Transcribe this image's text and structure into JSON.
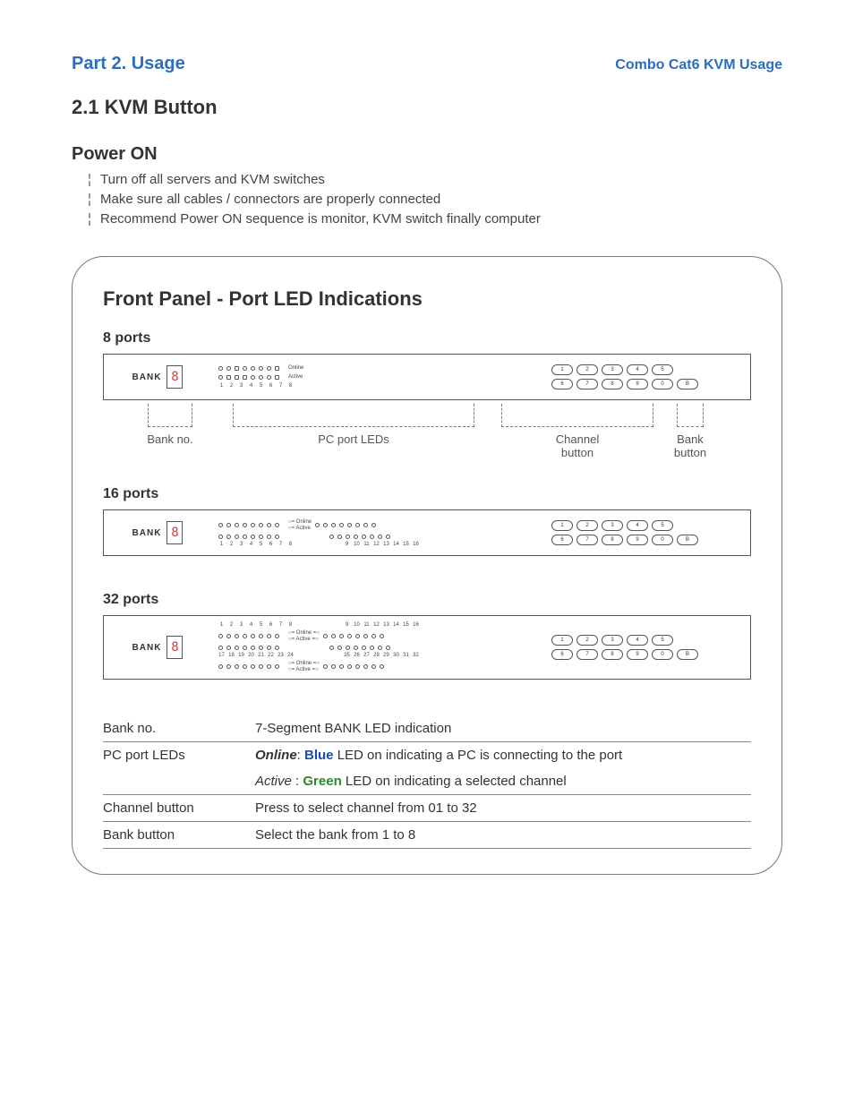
{
  "header": {
    "left": "Part 2. Usage",
    "right": "Combo Cat6 KVM Usage"
  },
  "section_title": "2.1  KVM Button",
  "power_on": {
    "title": "Power ON",
    "items": [
      "Turn off all servers and KVM switches",
      "Make sure all cables / connectors are properly connected",
      "Recommend Power ON sequence is monitor, KVM switch finally computer"
    ]
  },
  "panel": {
    "title": "Front Panel - Port LED Indications",
    "ports8": "8 ports",
    "ports16": "16 ports",
    "ports32": "32 ports",
    "bank_label": "BANK",
    "seg7_value": "8",
    "led_legend_online": "Online",
    "led_legend_active": "Active",
    "channel_buttons_row1": [
      "1",
      "2",
      "3",
      "4",
      "5"
    ],
    "channel_buttons_row2": [
      "6",
      "7",
      "8",
      "9",
      "0",
      "B"
    ],
    "callouts": {
      "bank_no": "Bank no.",
      "pc_leds": "PC port LEDs",
      "channel_btn": "Channel\nbutton",
      "bank_btn": "Bank\nbutton"
    }
  },
  "legend": {
    "rows": [
      {
        "k": "Bank no.",
        "v_plain": "7-Segment BANK LED indication"
      },
      {
        "k": "PC port LEDs",
        "v_online_prefix": "Online",
        "v_online_mid": ": ",
        "v_online_color": "Blue",
        "v_online_rest": " LED on indicating a PC is connecting to the port"
      },
      {
        "k": "",
        "v_active_prefix": "Active",
        "v_active_mid": " : ",
        "v_active_color": "Green",
        "v_active_rest": " LED on indicating a selected channel"
      },
      {
        "k": "Channel button",
        "v_plain": "Press to select channel from 01 to 32"
      },
      {
        "k": "Bank button",
        "v_plain": "Select the bank from 1 to 8"
      }
    ]
  }
}
